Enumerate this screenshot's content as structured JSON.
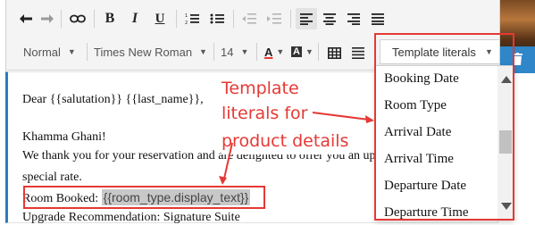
{
  "toolbar": {
    "undo_icon": "undo-icon",
    "redo_icon": "redo-icon",
    "link_icon": "link-icon",
    "bold": "B",
    "italic": "I",
    "underline": "U",
    "paragraph_style": "Normal",
    "font_family": "Times New Roman",
    "font_size": "14",
    "font_color_label": "A",
    "highlight_label": "A",
    "template_literals": "Template literals"
  },
  "editor": {
    "lines": [
      "Dear {{salutation}} {{last_name}},",
      "Khamma Ghani!",
      "We thank you for your reservation and are delighted to offer you an up",
      "special rate.",
      "Room Booked: ",
      "Upgrade Recommendation: Signature Suite"
    ],
    "room_template": "{{room_type.display_text}}"
  },
  "annotation": {
    "line1": "Template",
    "line2": "literals for",
    "line3": "product details"
  },
  "dropdown": {
    "items": [
      "Booking Date",
      "Room Type",
      "Arrival Date",
      "Arrival Time",
      "Departure Date",
      "Departure Time"
    ]
  },
  "colors": {
    "annotation_red": "#e53935",
    "editor_accent": "#2e7bc1",
    "template_highlight": "#c8c8c8"
  }
}
